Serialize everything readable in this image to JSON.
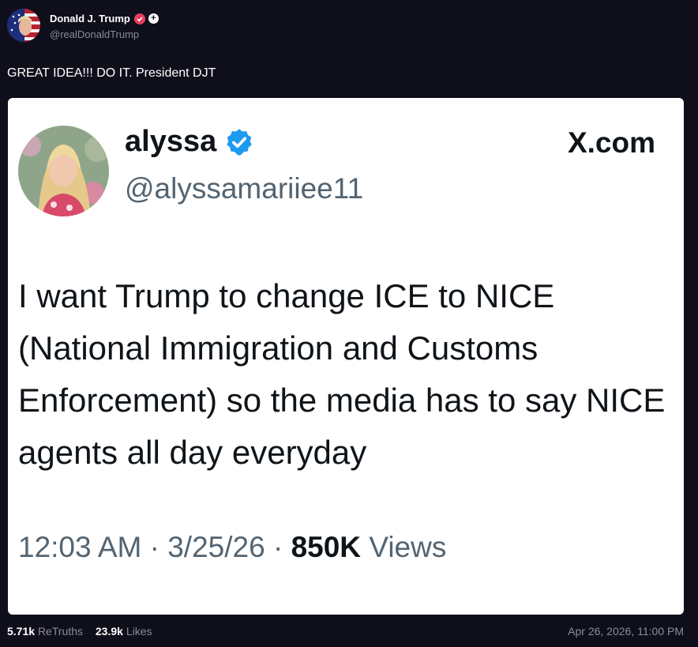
{
  "author": {
    "display_name": "Donald J. Trump",
    "handle": "@realDonaldTrump",
    "plus_glyph": "+"
  },
  "post": {
    "text": "GREAT IDEA!!! DO IT.  President DJT"
  },
  "quoted": {
    "name": "alyssa",
    "handle": "@alyssamariiee11",
    "site": "X.com",
    "body": "I want Trump to change ICE to NICE (National Immigration and Customs Enforcement) so the media has to say NICE agents all day everyday",
    "time": "12:03 AM",
    "date": "3/25/26",
    "separator": "·",
    "views_count": "850K",
    "views_label": "Views"
  },
  "stats": {
    "retruths_count": "5.71k",
    "retruths_label": "ReTruths",
    "likes_count": "23.9k",
    "likes_label": "Likes",
    "timestamp": "Apr 26, 2026, 11:00 PM"
  },
  "colors": {
    "background": "#0f0f1b",
    "card": "#ffffff",
    "verified_pink": "#e83d5c",
    "x_verified_blue": "#1d9bf0",
    "muted": "#8b8b9b"
  },
  "icons": [
    "avatar",
    "verified-badge-icon",
    "truth-plus-icon",
    "x-verified-icon",
    "x-logo-icon"
  ]
}
